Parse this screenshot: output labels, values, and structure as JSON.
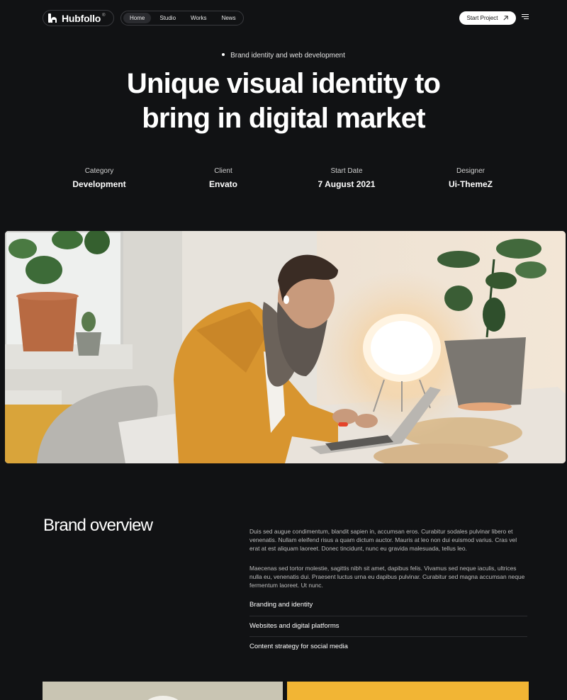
{
  "header": {
    "logo_text": "Hubfollo",
    "logo_reg": "®",
    "nav": [
      {
        "label": "Home",
        "active": true
      },
      {
        "label": "Studio",
        "active": false
      },
      {
        "label": "Works",
        "active": false
      },
      {
        "label": "News",
        "active": false
      }
    ],
    "cta_label": "Start Project"
  },
  "hero": {
    "tagline": "Brand identity and web development",
    "title_line1": "Unique visual identity to",
    "title_line2": "bring in digital market"
  },
  "meta": [
    {
      "label": "Category",
      "value": "Development"
    },
    {
      "label": "Client",
      "value": "Envato"
    },
    {
      "label": "Start Date",
      "value": "7 August 2021"
    },
    {
      "label": "Designer",
      "value": "Ui-ThemeZ"
    }
  ],
  "overview": {
    "title": "Brand overview",
    "paragraph1": "Duis sed augue condimentum, blandit sapien in, accumsan eros. Curabitur sodales pulvinar libero et venenatis. Nullam eleifend risus a quam dictum auctor. Mauris at leo non dui euismod varius. Cras vel erat at est aliquam laoreet. Donec tincidunt, nunc eu gravida malesuada, tellus leo.",
    "paragraph2": "Maecenas sed tortor molestie, sagittis nibh sit amet, dapibus felis. Vivamus sed neque iaculis, ultrices nulla eu, venenatis dui. Praesent luctus urna eu dapibus pulvinar. Curabitur sed magna accumsan neque fermentum laoreet. Ut nunc.",
    "services": [
      "Branding and identity",
      "Websites and digital platforms",
      "Content strategy for social media"
    ]
  },
  "colors": {
    "background": "#111214",
    "card_left": "#c9c5b3",
    "card_right": "#f2b534"
  }
}
